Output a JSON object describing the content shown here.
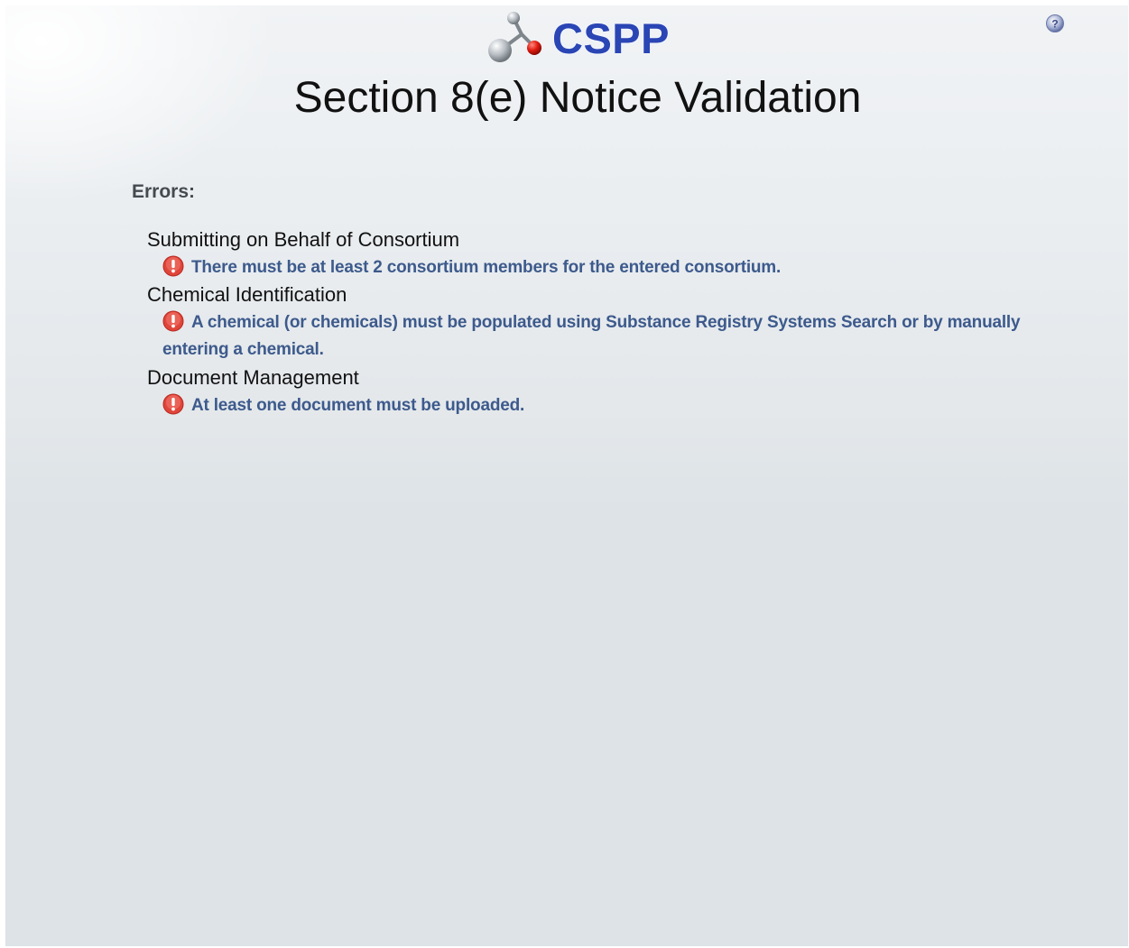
{
  "header": {
    "app_name": "CSPP",
    "page_title": "Section 8(e) Notice Validation",
    "help_icon": "help-icon"
  },
  "errors": {
    "heading": "Errors:",
    "sections": [
      {
        "title": "Submitting on Behalf of Consortium",
        "messages": [
          "There must be at least 2 consortium members for the entered consortium."
        ]
      },
      {
        "title": "Chemical Identification",
        "messages": [
          "A chemical (or chemicals) must be populated using Substance Registry Systems Search or by manually entering a chemical."
        ]
      },
      {
        "title": "Document Management",
        "messages": [
          "At least one document must be uploaded."
        ]
      }
    ]
  },
  "colors": {
    "brand": "#2a45b4",
    "error_text": "#3d5a8c",
    "error_icon": "#e0453a",
    "background": "#e3e7ea"
  }
}
